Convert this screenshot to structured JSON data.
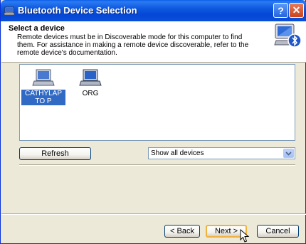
{
  "window": {
    "title": "Bluetooth Device Selection",
    "help_label": "?",
    "close_label": "✕"
  },
  "header": {
    "title": "Select a device",
    "description": "Remote devices must be in Discoverable mode for this computer to find them. For assistance in making a remote device discoverable, refer to the remote device's documentation."
  },
  "devices": [
    {
      "name": "CATHYLAPTOP",
      "display": "CATHYLAPTO P",
      "selected": true,
      "icon": "laptop-icon"
    },
    {
      "name": "ORG",
      "display": "ORG",
      "selected": false,
      "icon": "laptop-icon"
    }
  ],
  "controls": {
    "refresh_label": "Refresh",
    "filter_value": "Show all devices"
  },
  "footer": {
    "back_label": "< Back",
    "next_label": "Next >",
    "cancel_label": "Cancel"
  },
  "colors": {
    "titlebar": "#0546d6",
    "selection": "#316ac5",
    "window_bg": "#ece9d8"
  }
}
